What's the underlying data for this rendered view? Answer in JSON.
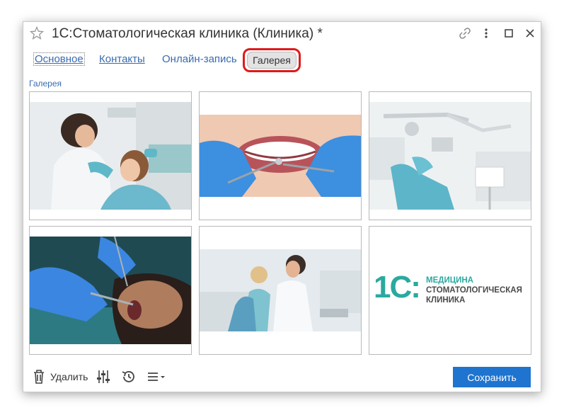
{
  "window": {
    "title": "1С:Стоматологическая клиника (Клиника) *"
  },
  "tabs": {
    "main": "Основное",
    "contacts": "Контакты",
    "online": "Онлайн-запись",
    "gallery": "Галерея"
  },
  "gallery": {
    "label": "Галерея",
    "logo": {
      "mark": "1С:",
      "line1": "МЕДИЦИНА",
      "line2": "СТОМАТОЛОГИЧЕСКАЯ",
      "line3": "КЛИНИКА"
    }
  },
  "toolbar": {
    "delete_label": "Удалить",
    "save_label": "Сохранить"
  },
  "colors": {
    "accent": "#1e74cf",
    "link": "#3a6bb0",
    "highlight": "#e01a1a",
    "logo_teal": "#2aa9a0"
  }
}
